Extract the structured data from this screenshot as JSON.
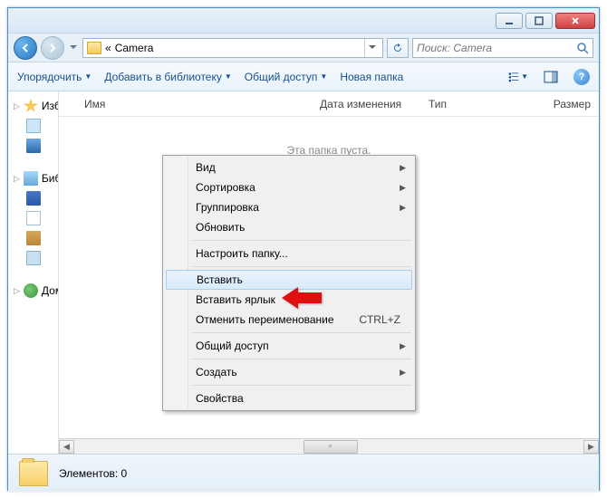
{
  "breadcrumb": {
    "prefix": "«",
    "current": "Camera"
  },
  "search": {
    "placeholder": "Поиск: Camera"
  },
  "toolbar": {
    "organize": "Упорядочить",
    "library": "Добавить в библиотеку",
    "share": "Общий доступ",
    "newfolder": "Новая папка"
  },
  "columns": {
    "name": "Имя",
    "date": "Дата изменения",
    "type": "Тип",
    "size": "Размер"
  },
  "empty": "Эта папка пуста.",
  "sidebar": {
    "fav": "Избранное",
    "lib": "Библиотеки",
    "home": "Домашняя группа"
  },
  "context": {
    "view": "Вид",
    "sort": "Сортировка",
    "group": "Группировка",
    "refresh": "Обновить",
    "customize": "Настроить папку...",
    "paste": "Вставить",
    "paste_shortcut": "Вставить ярлык",
    "undo": "Отменить переименование",
    "undo_key": "CTRL+Z",
    "share": "Общий доступ",
    "new": "Создать",
    "props": "Свойства"
  },
  "status": {
    "label": "Элементов: 0"
  }
}
